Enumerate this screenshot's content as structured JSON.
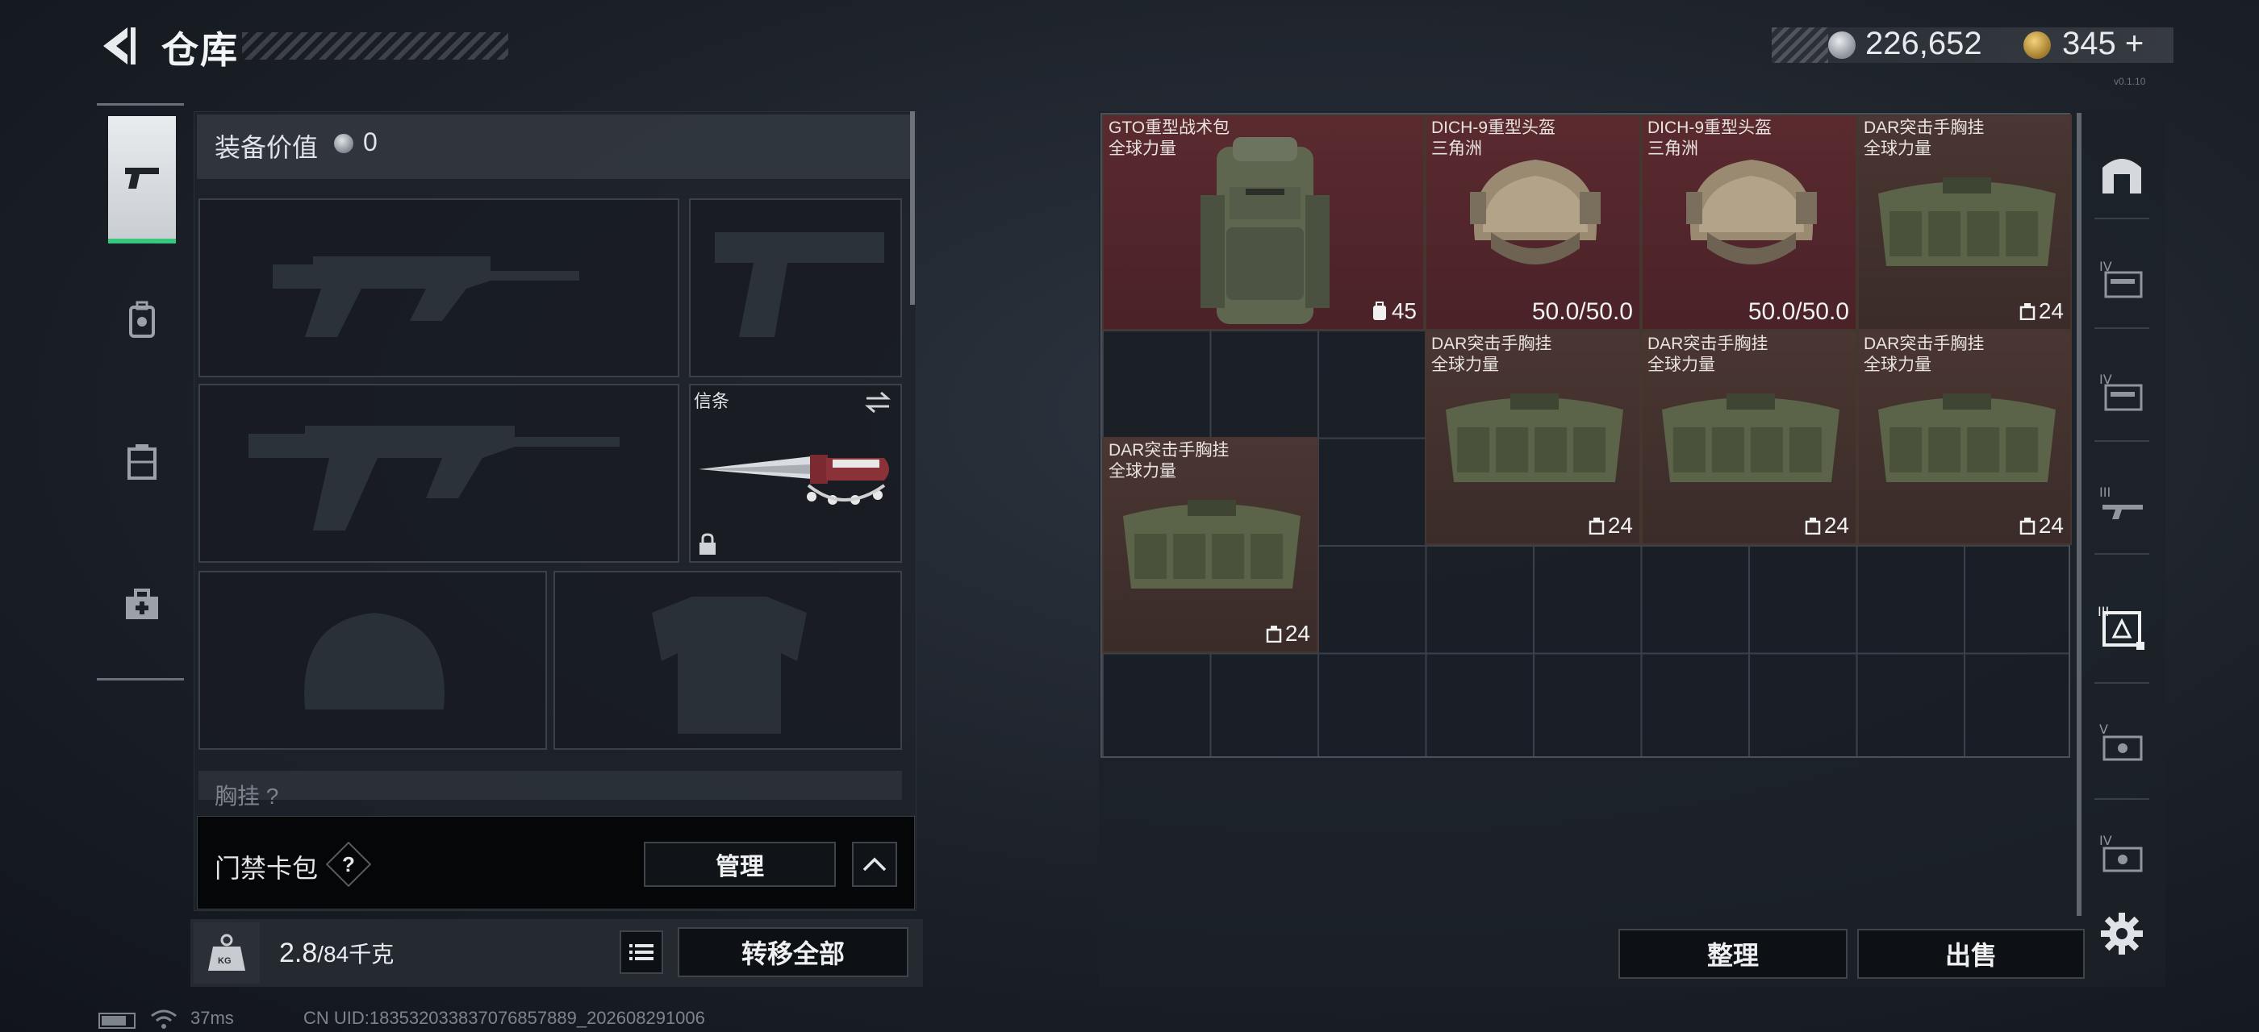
{
  "header": {
    "title": "仓库",
    "silver_amount": "226,652",
    "gold_amount": "345",
    "gold_plus": "+",
    "version": "v0.1.10"
  },
  "left_tabs": [
    {
      "name": "weapons",
      "icon": "pistol-icon",
      "active": true
    },
    {
      "name": "backpack",
      "icon": "backpack-icon",
      "active": false
    },
    {
      "name": "chest-rig",
      "icon": "chest-rig-icon",
      "active": false
    },
    {
      "name": "medical",
      "icon": "medkit-icon",
      "active": false
    }
  ],
  "loadout": {
    "equip_value_label": "装备价值",
    "equip_value": "0",
    "melee_label": "信条",
    "chest_rig_label": "胸挂 ?",
    "keycard_label": "门禁卡包",
    "keycard_help": "?",
    "manage_label": "管理",
    "weight_current": "2.8",
    "weight_max": "/84千克",
    "weight_icon_text": "KG",
    "transfer_all_label": "转移全部"
  },
  "stash": {
    "sort_label": "整理",
    "sell_label": "出售",
    "items": [
      {
        "name": "GTO重型战术包",
        "sub": "全球力量",
        "value": "45",
        "value_icon": "backpack-icon",
        "rarity": "red"
      },
      {
        "name": "DICH-9重型头盔",
        "sub": "三角洲",
        "value": "50.0/50.0",
        "value_icon": "durability",
        "rarity": "red"
      },
      {
        "name": "DICH-9重型头盔",
        "sub": "三角洲",
        "value": "50.0/50.0",
        "value_icon": "durability",
        "rarity": "red"
      },
      {
        "name": "DAR突击手胸挂",
        "sub": "全球力量",
        "value": "24",
        "value_icon": "chest-rig-icon",
        "rarity": "brown"
      },
      {
        "name": "DAR突击手胸挂",
        "sub": "全球力量",
        "value": "24",
        "value_icon": "chest-rig-icon",
        "rarity": "brown"
      },
      {
        "name": "DAR突击手胸挂",
        "sub": "全球力量",
        "value": "24",
        "value_icon": "chest-rig-icon",
        "rarity": "brown"
      },
      {
        "name": "DAR突击手胸挂",
        "sub": "全球力量",
        "value": "24",
        "value_icon": "chest-rig-icon",
        "rarity": "brown"
      },
      {
        "name": "DAR突击手胸挂",
        "sub": "全球力量",
        "value": "24",
        "value_icon": "chest-rig-icon",
        "rarity": "brown"
      }
    ],
    "side_tabs": [
      {
        "tier": "",
        "icon": "stash-home-icon"
      },
      {
        "tier": "IV",
        "icon": "stash-cabinet-icon"
      },
      {
        "tier": "IV",
        "icon": "stash-cabinet-icon"
      },
      {
        "tier": "III",
        "icon": "stash-weapon-rack-icon"
      },
      {
        "tier": "III",
        "icon": "stash-rig-icon",
        "active": true
      },
      {
        "tier": "V",
        "icon": "stash-case-icon"
      },
      {
        "tier": "IV",
        "icon": "stash-case-icon"
      }
    ]
  },
  "status_bar": {
    "ping": "37ms",
    "uid": "CN UID:1835320338370768578​89_202608291006"
  },
  "colors": {
    "accent_green": "#37c77e",
    "rarity_red": "#5a2a2f",
    "rarity_brown": "#4a3632"
  }
}
